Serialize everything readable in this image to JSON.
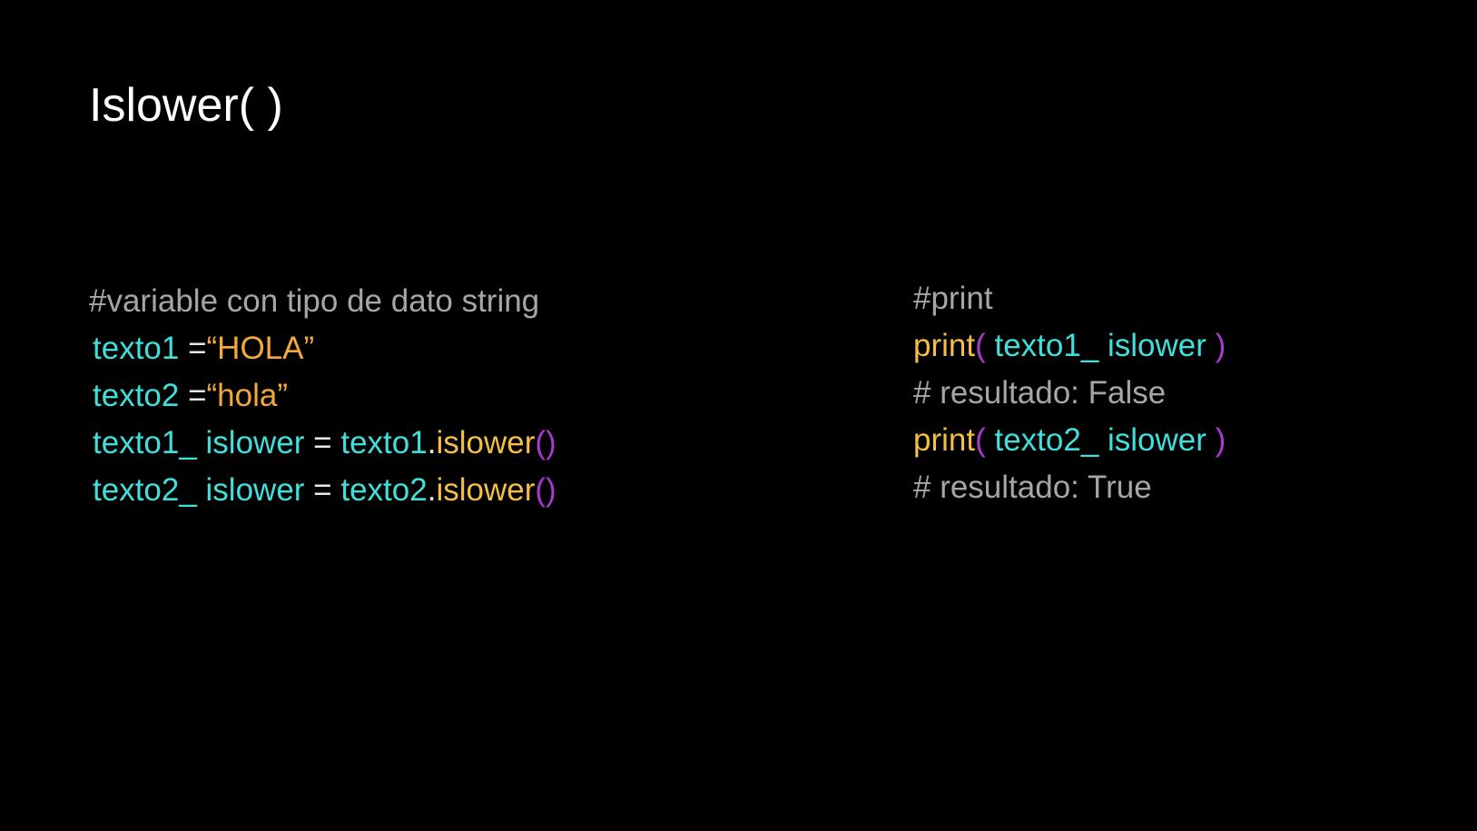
{
  "slide": {
    "title": "Islower( )"
  },
  "left_code": {
    "comment": "#variable con tipo de dato string",
    "line1": {
      "ident": "texto1",
      "eq": " =",
      "value": "“HOLA”"
    },
    "line2": {
      "ident": "texto2",
      "eq": " =",
      "value": "“hola”"
    },
    "line3": {
      "ident": "texto1_ islower",
      "eq": " = ",
      "obj": "texto1",
      "dot": ".",
      "method": "islower",
      "parens": "()"
    },
    "line4": {
      "ident": "texto2_ islower",
      "eq": " = ",
      "obj": "texto2",
      "dot": ".",
      "method": "islower",
      "parens": "()"
    }
  },
  "right_code": {
    "comment": "#print",
    "print1": {
      "func": "print",
      "open": "(",
      "arg": " texto1_ islower ",
      "close": ")"
    },
    "result1": "# resultado: False",
    "print2": {
      "func": "print",
      "open": "(",
      "arg": " texto2_ islower ",
      "close": ")"
    },
    "result2": "# resultado: True"
  },
  "colors": {
    "background": "#000000",
    "title": "#ffffff",
    "comment": "#a6a6a6",
    "identifier": "#3fe0dc",
    "string": "#f2a83b",
    "method": "#f5bf45",
    "paren": "#a63ad1"
  }
}
